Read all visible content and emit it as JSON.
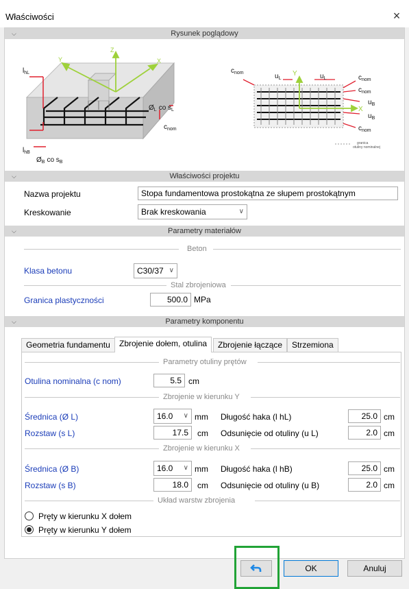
{
  "window": {
    "title": "Właściwości",
    "close_glyph": "×"
  },
  "sections": {
    "drawing": "Rysunek poglądowy",
    "project": "Właściwości projektu",
    "materials": "Parametry materiałów",
    "components": "Parametry komponentu"
  },
  "figure": {
    "left": {
      "axis_y": "Y",
      "axis_z": "Z",
      "axis_x": "X",
      "l_ht": "l",
      "l_ht_sub": "hL",
      "l_hb": "l",
      "l_hb_sub": "hB",
      "phi_l": "Ø",
      "phi_l_sub": "L",
      "phi_l_co": "co s",
      "phi_l_co_sub": "L",
      "phi_b": "Ø",
      "phi_b_sub": "B",
      "phi_b_co": "co s",
      "phi_b_co_sub": "B",
      "cnom": "c",
      "cnom_sub": "nom"
    },
    "right": {
      "cnom_left": "c",
      "cnom_left_sub": "nom",
      "ul_1": "u",
      "ul_1_sub": "L",
      "ul_2": "u",
      "ul_2_sub": "L",
      "axis_y": "Y",
      "axis_x": "X",
      "cnom_r1": "c",
      "cnom_r1_sub": "nom",
      "cnom_r2": "c",
      "cnom_r2_sub": "nom",
      "ub_1": "u",
      "ub_1_sub": "B",
      "ub_2": "u",
      "ub_2_sub": "B",
      "cnom_r3": "c",
      "cnom_r3_sub": "nom",
      "legend_line1": "granica",
      "legend_line2": "otuliny nominalnej"
    }
  },
  "project": {
    "name_label": "Nazwa projektu",
    "name_value": "Stopa fundamentowa prostokątna ze słupem prostokątnym",
    "hatching_label": "Kreskowanie",
    "hatching_value": "Brak kreskowania"
  },
  "materials": {
    "concrete_divider": "Beton",
    "concrete_class_label": "Klasa betonu",
    "concrete_class_value": "C30/37",
    "steel_divider": "Stal zbrojeniowa",
    "yield_label": "Granica plastyczności",
    "yield_value": "500.0",
    "yield_unit": "MPa"
  },
  "tabs": [
    {
      "label": "Geometria fundamentu"
    },
    {
      "label": "Zbrojenie dołem, otulina"
    },
    {
      "label": "Zbrojenie łączące"
    },
    {
      "label": "Strzemiona"
    }
  ],
  "bottom_reinf": {
    "cover_divider": "Parametry otuliny prętów",
    "cover_label": "Otulina nominalna (c nom)",
    "cover_value": "5.5",
    "cover_unit": "cm",
    "y_divider": "Zbrojenie w kierunku Y",
    "y_diam_label": "Średnica (Ø L)",
    "y_diam_value": "16.0",
    "y_diam_unit": "mm",
    "y_hook_label": "Długość haka (l hL)",
    "y_hook_value": "25.0",
    "y_hook_unit": "cm",
    "y_spacing_label": "Rozstaw (s L)",
    "y_spacing_value": "17.5",
    "y_spacing_unit": "cm",
    "y_offset_label": "Odsunięcie od otuliny (u L)",
    "y_offset_value": "2.0",
    "y_offset_unit": "cm",
    "x_divider": "Zbrojenie w kierunku X",
    "x_diam_label": "Średnica (Ø B)",
    "x_diam_value": "16.0",
    "x_diam_unit": "mm",
    "x_hook_label": "Długość haka (l hB)",
    "x_hook_value": "25.0",
    "x_hook_unit": "cm",
    "x_spacing_label": "Rozstaw (s B)",
    "x_spacing_value": "18.0",
    "x_spacing_unit": "cm",
    "x_offset_label": "Odsunięcie od otuliny (u B)",
    "x_offset_value": "2.0",
    "x_offset_unit": "cm",
    "layers_divider": "Układ warstw zbrojenia",
    "radio_x_label": "Pręty w kierunku X dołem",
    "radio_y_label": "Pręty w kierunku Y dołem",
    "selected_radio": "y"
  },
  "buttons": {
    "undo_icon": "undo-icon",
    "ok": "OK",
    "cancel": "Anuluj"
  },
  "colors": {
    "highlight": "#21a336",
    "accent_blue": "#1a3cb8",
    "arrow_red": "#e0202f",
    "axis_green": "#9ed13a"
  }
}
